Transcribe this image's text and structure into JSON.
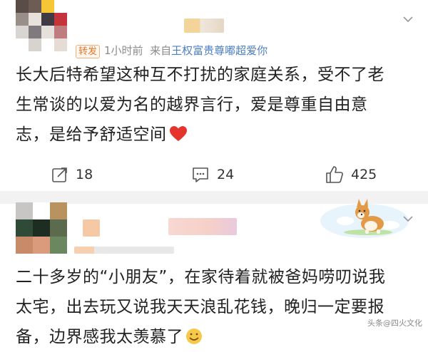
{
  "post1": {
    "avatar_label": "user-avatar",
    "username_blurred": "",
    "repost_badge": "转发",
    "time": "1小时前",
    "source_prefix": "来自",
    "source_name": "王权富贵尊嘟超爱你",
    "content_line1": "长大后特希望这种互不打扰的家庭关系，受不了老",
    "content_line2": "生常谈的以爱为名的越界言行，爱是尊重自由意",
    "content_line3": "志，是给予舒适空间",
    "heart_icon": "red-heart",
    "actions": {
      "share_count": "18",
      "comment_count": "24",
      "like_count": "425"
    }
  },
  "post2": {
    "content_line1": "二十多岁的“小朋友”，在家待着就被爸妈唠叨说我",
    "content_line2": "太宅，出去玩又说我天天浪乱花钱，晚归一定要报",
    "content_line3": "备，边界感我太羡慕了",
    "emoji_icon": "smiling-emoji",
    "sticker": "corgi-sticker"
  },
  "colors": {
    "accent_blue": "#4b7fc3",
    "repost_orange": "#e0782a",
    "heart_red": "#e5342b"
  },
  "watermark": "头条@四火文化"
}
